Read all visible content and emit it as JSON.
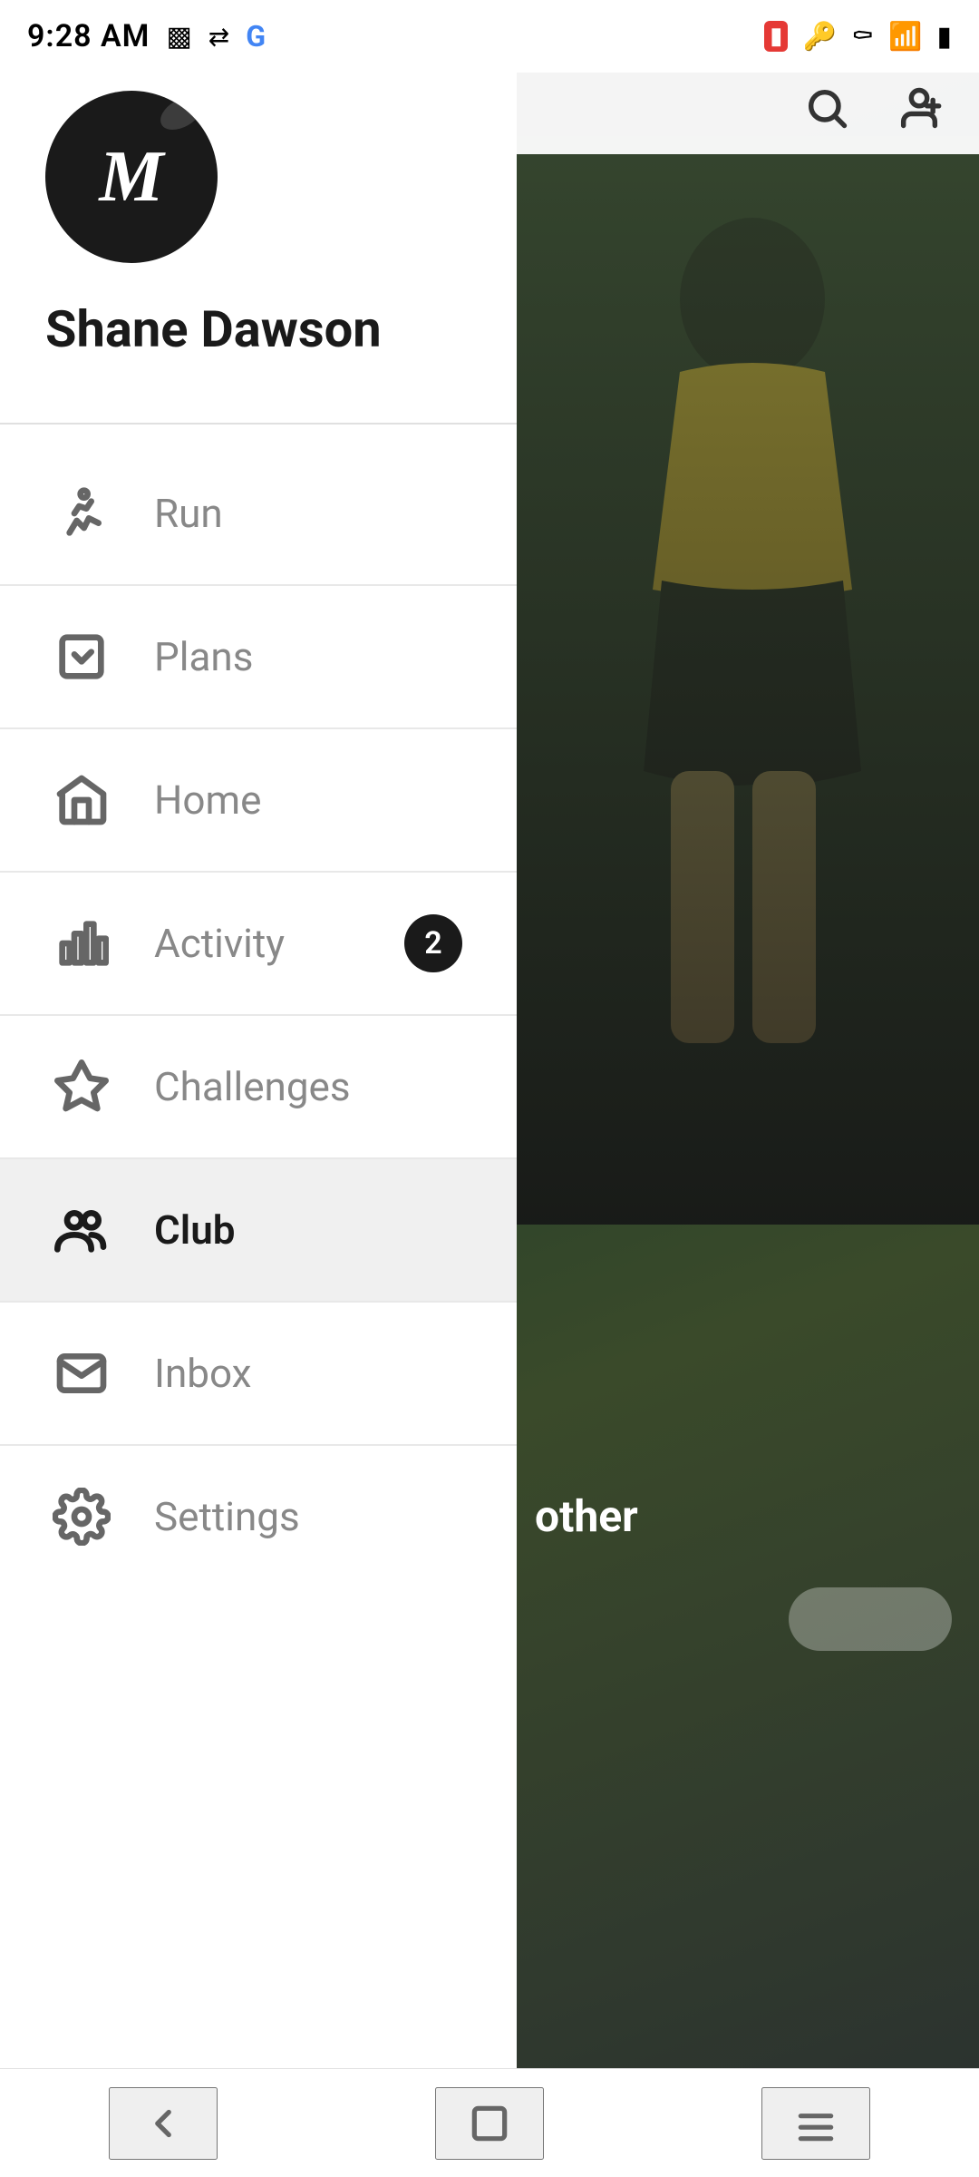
{
  "statusBar": {
    "time": "9:28 AM",
    "icons": [
      "video-icon",
      "sim-icon",
      "google-icon",
      "camera-record-icon",
      "key-icon",
      "bluetooth-icon",
      "wifi-icon",
      "battery-icon"
    ]
  },
  "sidebar": {
    "user": {
      "name": "Shane Dawson",
      "avatarLetter": "M"
    },
    "navItems": [
      {
        "id": "run",
        "label": "Run",
        "icon": "run-icon",
        "badge": null,
        "active": false
      },
      {
        "id": "plans",
        "label": "Plans",
        "icon": "plans-icon",
        "badge": null,
        "active": false
      },
      {
        "id": "home",
        "label": "Home",
        "icon": "home-icon",
        "badge": null,
        "active": false
      },
      {
        "id": "activity",
        "label": "Activity",
        "icon": "activity-icon",
        "badge": "2",
        "active": false
      },
      {
        "id": "challenges",
        "label": "Challenges",
        "icon": "challenges-icon",
        "badge": null,
        "active": false
      },
      {
        "id": "club",
        "label": "Club",
        "icon": "club-icon",
        "badge": null,
        "active": true
      },
      {
        "id": "inbox",
        "label": "Inbox",
        "icon": "inbox-icon",
        "badge": null,
        "active": false
      },
      {
        "id": "settings",
        "label": "Settings",
        "icon": "settings-icon",
        "badge": null,
        "active": false
      }
    ]
  },
  "rightPanel": {
    "overlayText": "other",
    "searchLabel": "search",
    "addUserLabel": "add user"
  },
  "bottomNav": {
    "buttons": [
      "back-button",
      "home-button",
      "menu-button"
    ]
  }
}
